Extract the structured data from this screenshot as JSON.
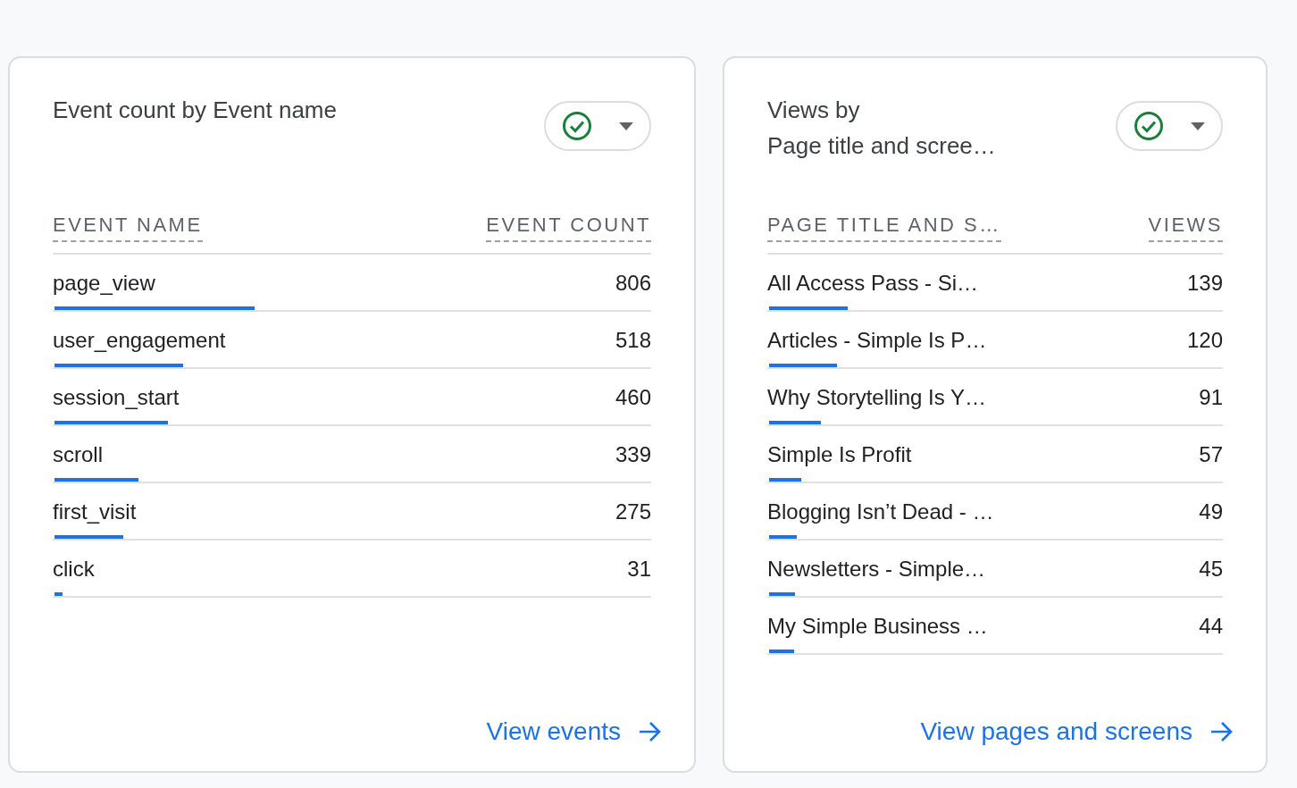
{
  "cards": [
    {
      "title": [
        "Event count by Event name"
      ],
      "columns": [
        "EVENT NAME",
        "EVENT COUNT"
      ],
      "rows": [
        {
          "name": "page_view",
          "value": "806",
          "level": 0.334
        },
        {
          "name": "user_engagement",
          "value": "518",
          "level": 0.215
        },
        {
          "name": "session_start",
          "value": "460",
          "level": 0.19
        },
        {
          "name": "scroll",
          "value": "339",
          "level": 0.141
        },
        {
          "name": "first_visit",
          "value": "275",
          "level": 0.115
        },
        {
          "name": "click",
          "value": "31",
          "level": 0.013
        }
      ],
      "link": "View events"
    },
    {
      "title": [
        "Views by",
        "Page title and scree…"
      ],
      "columns": [
        "PAGE TITLE AND S…",
        "VIEWS"
      ],
      "rows": [
        {
          "name": "All Access Pass - Si…",
          "value": "139",
          "level": 0.173
        },
        {
          "name": "Articles - Simple Is P…",
          "value": "120",
          "level": 0.149
        },
        {
          "name": "Why Storytelling Is Y…",
          "value": "91",
          "level": 0.114
        },
        {
          "name": "Simple Is Profit",
          "value": "57",
          "level": 0.071
        },
        {
          "name": "Blogging Isn’t Dead - …",
          "value": "49",
          "level": 0.061
        },
        {
          "name": "Newsletters - Simple…",
          "value": "45",
          "level": 0.057
        },
        {
          "name": "My Simple Business …",
          "value": "44",
          "level": 0.055
        }
      ],
      "link": "View pages and screens"
    }
  ]
}
